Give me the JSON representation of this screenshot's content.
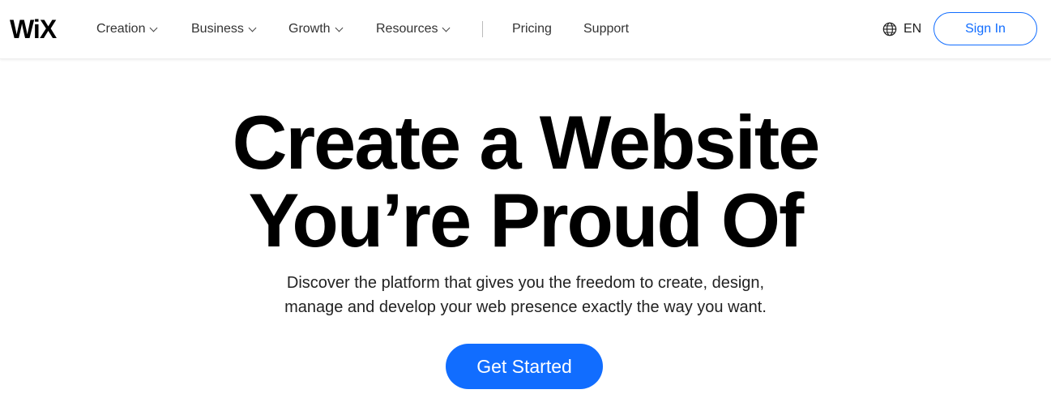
{
  "header": {
    "logo": "WiX",
    "nav": [
      {
        "label": "Creation",
        "has_dropdown": true
      },
      {
        "label": "Business",
        "has_dropdown": true
      },
      {
        "label": "Growth",
        "has_dropdown": true
      },
      {
        "label": "Resources",
        "has_dropdown": true
      },
      {
        "label": "Pricing",
        "has_dropdown": false
      },
      {
        "label": "Support",
        "has_dropdown": false
      }
    ],
    "language": {
      "icon": "globe-icon",
      "label": "EN"
    },
    "sign_in_label": "Sign In"
  },
  "hero": {
    "title_line1": "Create a Website",
    "title_line2": "You’re Proud Of",
    "subtitle_line1": "Discover the platform that gives you the freedom to create, design,",
    "subtitle_line2": "manage and develop your web presence exactly the way you want.",
    "cta_label": "Get Started"
  },
  "colors": {
    "accent": "#116dff",
    "text": "#000000"
  }
}
